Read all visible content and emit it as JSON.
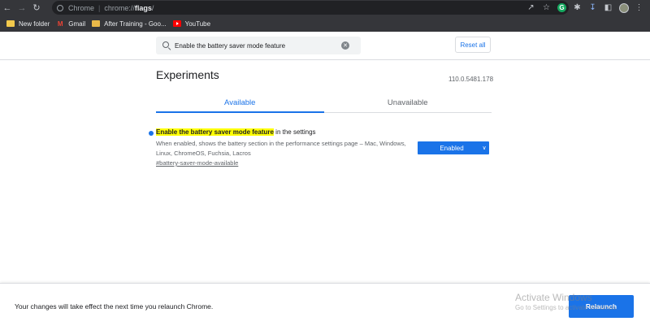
{
  "browser": {
    "scheme": "Chrome",
    "url_prefix": "chrome://",
    "url_host": "flags",
    "url_suffix": "/",
    "bookmarks": [
      {
        "label": "New folder",
        "icon": "folder-icon"
      },
      {
        "label": "Gmail",
        "icon": "gmail-icon"
      },
      {
        "label": "After Training - Goo...",
        "icon": "sheet-icon"
      },
      {
        "label": "YouTube",
        "icon": "youtube-icon"
      }
    ]
  },
  "header": {
    "search_value": "Enable the battery saver mode feature",
    "reset_label": "Reset all"
  },
  "main": {
    "title": "Experiments",
    "version": "110.0.5481.178",
    "tabs": [
      {
        "label": "Available",
        "active": true
      },
      {
        "label": "Unavailable",
        "active": false
      }
    ],
    "experiment": {
      "title_highlight": "Enable the battery saver mode feature",
      "title_rest": " in the settings",
      "description": "When enabled, shows the battery section in the performance settings page – Mac, Windows, Linux, ChromeOS, Fuchsia, Lacros",
      "link": "#battery-saver-mode-available",
      "select_value": "Enabled"
    }
  },
  "footer": {
    "message": "Your changes will take effect the next time you relaunch Chrome.",
    "relaunch_label": "Relaunch"
  },
  "watermark": {
    "line1": "Activate Windows",
    "line2": "Go to Settings to activate Windows."
  },
  "colors": {
    "accent": "#1a73e8",
    "highlight": "#ffff00",
    "toolbar": "#35363a"
  }
}
